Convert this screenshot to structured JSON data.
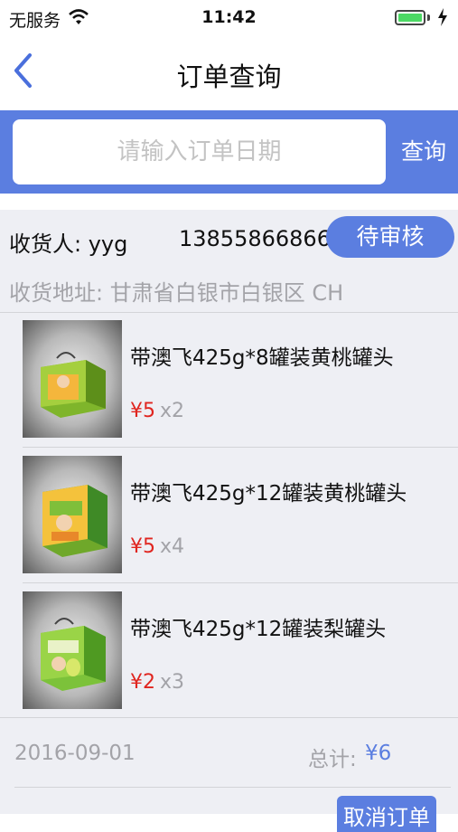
{
  "status_bar": {
    "carrier": "无服务",
    "time": "11:42",
    "battery_color": "#4cd964"
  },
  "nav": {
    "title": "订单查询",
    "back_icon": "chevron-left-icon"
  },
  "search": {
    "placeholder": "请输入订单日期",
    "value": "",
    "button_label": "查询"
  },
  "order": {
    "receiver_label": "收货人: yyg",
    "phone": "13855866866",
    "status": "待审核",
    "address": "收货地址: 甘肃省白银市白银区 CH",
    "items": [
      {
        "name": "带澳飞425g*8罐装黄桃罐头",
        "price": "¥5",
        "qty": "x2"
      },
      {
        "name": "带澳飞425g*12罐装黄桃罐头",
        "price": "¥5",
        "qty": "x4"
      },
      {
        "name": "带澳飞425g*12罐装梨罐头",
        "price": "¥2",
        "qty": "x3"
      }
    ],
    "date": "2016-09-01",
    "total_label": "总计:",
    "total_value": "¥6",
    "cancel_label": "取消订单"
  },
  "colors": {
    "accent": "#5b7ee0",
    "price": "#e0251f",
    "muted": "#a3a3a8",
    "card_bg": "#eeeff4"
  }
}
